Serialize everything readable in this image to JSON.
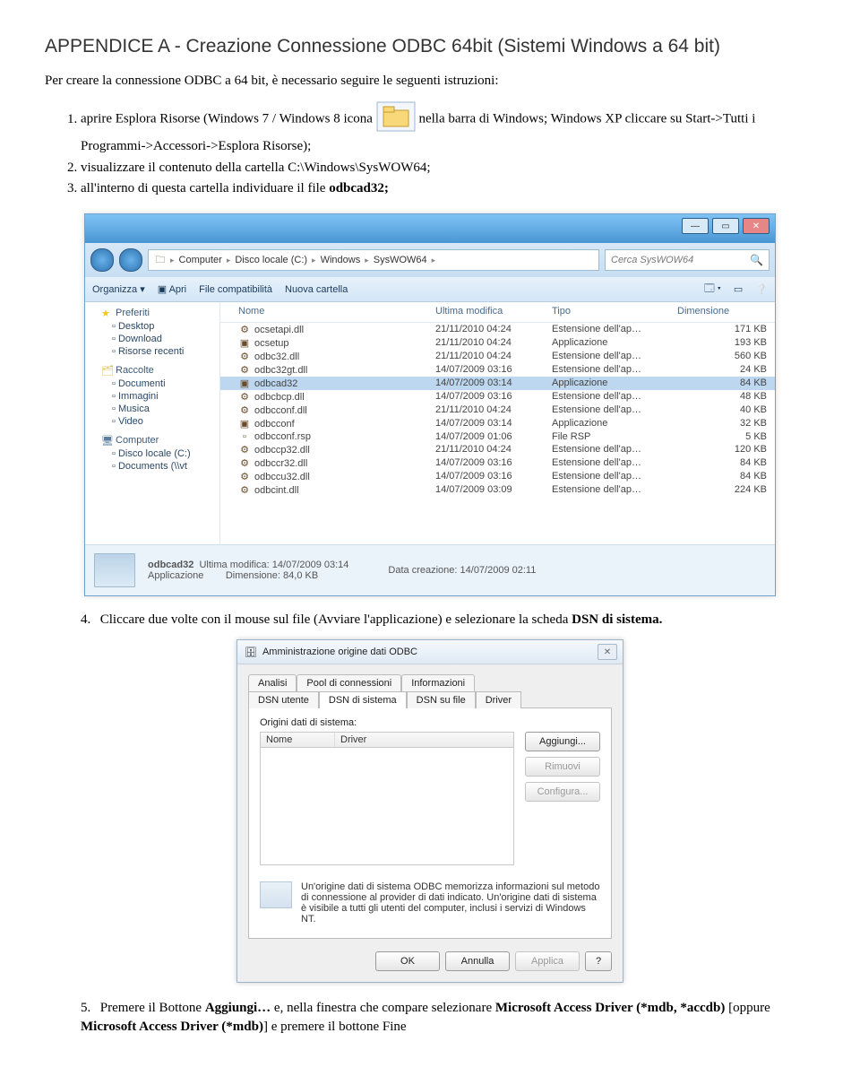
{
  "title": "APPENDICE A - Creazione Connessione ODBC 64bit (Sistemi Windows a 64 bit)",
  "intro": "Per creare la connessione ODBC a 64 bit, è necessario seguire le seguenti istruzioni:",
  "steps": {
    "s1a": "aprire Esplora Risorse (Windows 7 / Windows 8 icona ",
    "s1b": " nella barra di Windows; Windows XP cliccare su Start->Tutti i Programmi->Accessori->Esplora Risorse);",
    "s2": "visualizzare il contenuto della cartella C:\\Windows\\SysWOW64;",
    "s3a": "all'interno di questa cartella individuare il file ",
    "s3b": "odbcad32;"
  },
  "explorer": {
    "breadcrumbs": [
      "Computer",
      "Disco locale (C:)",
      "Windows",
      "SysWOW64"
    ],
    "searchPlaceholder": "Cerca SysWOW64",
    "toolbar": [
      "Organizza ▾",
      "Apri",
      "File compatibilità",
      "Nuova cartella"
    ],
    "sidebar": {
      "fav": {
        "hd": "Preferiti",
        "items": [
          "Desktop",
          "Download",
          "Risorse recenti"
        ]
      },
      "rac": {
        "hd": "Raccolte",
        "items": [
          "Documenti",
          "Immagini",
          "Musica",
          "Video"
        ]
      },
      "comp": {
        "hd": "Computer",
        "items": [
          "Disco locale (C:)",
          "Documents (\\\\vt"
        ]
      }
    },
    "cols": [
      "Nome",
      "Ultima modifica",
      "Tipo",
      "Dimensione"
    ],
    "files": [
      {
        "n": "ocsetapi.dll",
        "m": "21/11/2010 04:24",
        "t": "Estensione dell'ap…",
        "s": "171 KB",
        "ic": "⚙"
      },
      {
        "n": "ocsetup",
        "m": "21/11/2010 04:24",
        "t": "Applicazione",
        "s": "193 KB",
        "ic": "▣"
      },
      {
        "n": "odbc32.dll",
        "m": "21/11/2010 04:24",
        "t": "Estensione dell'ap…",
        "s": "560 KB",
        "ic": "⚙"
      },
      {
        "n": "odbc32gt.dll",
        "m": "14/07/2009 03:16",
        "t": "Estensione dell'ap…",
        "s": "24 KB",
        "ic": "⚙"
      },
      {
        "n": "odbcad32",
        "m": "14/07/2009 03:14",
        "t": "Applicazione",
        "s": "84 KB",
        "ic": "▣",
        "sel": true
      },
      {
        "n": "odbcbcp.dll",
        "m": "14/07/2009 03:16",
        "t": "Estensione dell'ap…",
        "s": "48 KB",
        "ic": "⚙"
      },
      {
        "n": "odbcconf.dll",
        "m": "21/11/2010 04:24",
        "t": "Estensione dell'ap…",
        "s": "40 KB",
        "ic": "⚙"
      },
      {
        "n": "odbcconf",
        "m": "14/07/2009 03:14",
        "t": "Applicazione",
        "s": "32 KB",
        "ic": "▣"
      },
      {
        "n": "odbcconf.rsp",
        "m": "14/07/2009 01:06",
        "t": "File RSP",
        "s": "5 KB",
        "ic": "▫"
      },
      {
        "n": "odbccp32.dll",
        "m": "21/11/2010 04:24",
        "t": "Estensione dell'ap…",
        "s": "120 KB",
        "ic": "⚙"
      },
      {
        "n": "odbccr32.dll",
        "m": "14/07/2009 03:16",
        "t": "Estensione dell'ap…",
        "s": "84 KB",
        "ic": "⚙"
      },
      {
        "n": "odbccu32.dll",
        "m": "14/07/2009 03:16",
        "t": "Estensione dell'ap…",
        "s": "84 KB",
        "ic": "⚙"
      },
      {
        "n": "odbcint.dll",
        "m": "14/07/2009 03:09",
        "t": "Estensione dell'ap…",
        "s": "224 KB",
        "ic": "⚙"
      }
    ],
    "status": {
      "name": "odbcad32",
      "l1": "Ultima modifica: 14/07/2009 03:14",
      "l2": "Applicazione",
      "l3": "Dimensione: 84,0 KB",
      "r1": "Data creazione: 14/07/2009 02:11"
    }
  },
  "step4": "Cliccare due volte con il mouse sul file (Avviare l'applicazione) e selezionare la scheda ",
  "step4b": "DSN di sistema.",
  "odbc": {
    "title": "Amministrazione origine dati ODBC",
    "tabs1": [
      "Analisi",
      "Pool di connessioni",
      "Informazioni"
    ],
    "tabs2": [
      "DSN utente",
      "DSN di sistema",
      "DSN su file",
      "Driver"
    ],
    "label": "Origini dati di sistema:",
    "cols": [
      "Nome",
      "Driver"
    ],
    "btns": {
      "add": "Aggiungi...",
      "rm": "Rimuovi",
      "cfg": "Configura..."
    },
    "info": "Un'origine dati di sistema ODBC memorizza informazioni sul metodo di connessione al provider di dati indicato. Un'origine dati di sistema è visibile a tutti gli utenti del computer, inclusi i servizi di Windows NT.",
    "dlgbtns": [
      "OK",
      "Annulla",
      "Applica",
      "?"
    ]
  },
  "step5a": "Premere il Bottone ",
  "step5b": "Aggiungi…",
  "step5c": " e, nella finestra che compare selezionare ",
  "step5d": "Microsoft Access Driver (*mdb, *accdb)",
  "step5e": " [oppure ",
  "step5f": "Microsoft Access Driver (*mdb)",
  "step5g": "] e premere il bottone Fine"
}
